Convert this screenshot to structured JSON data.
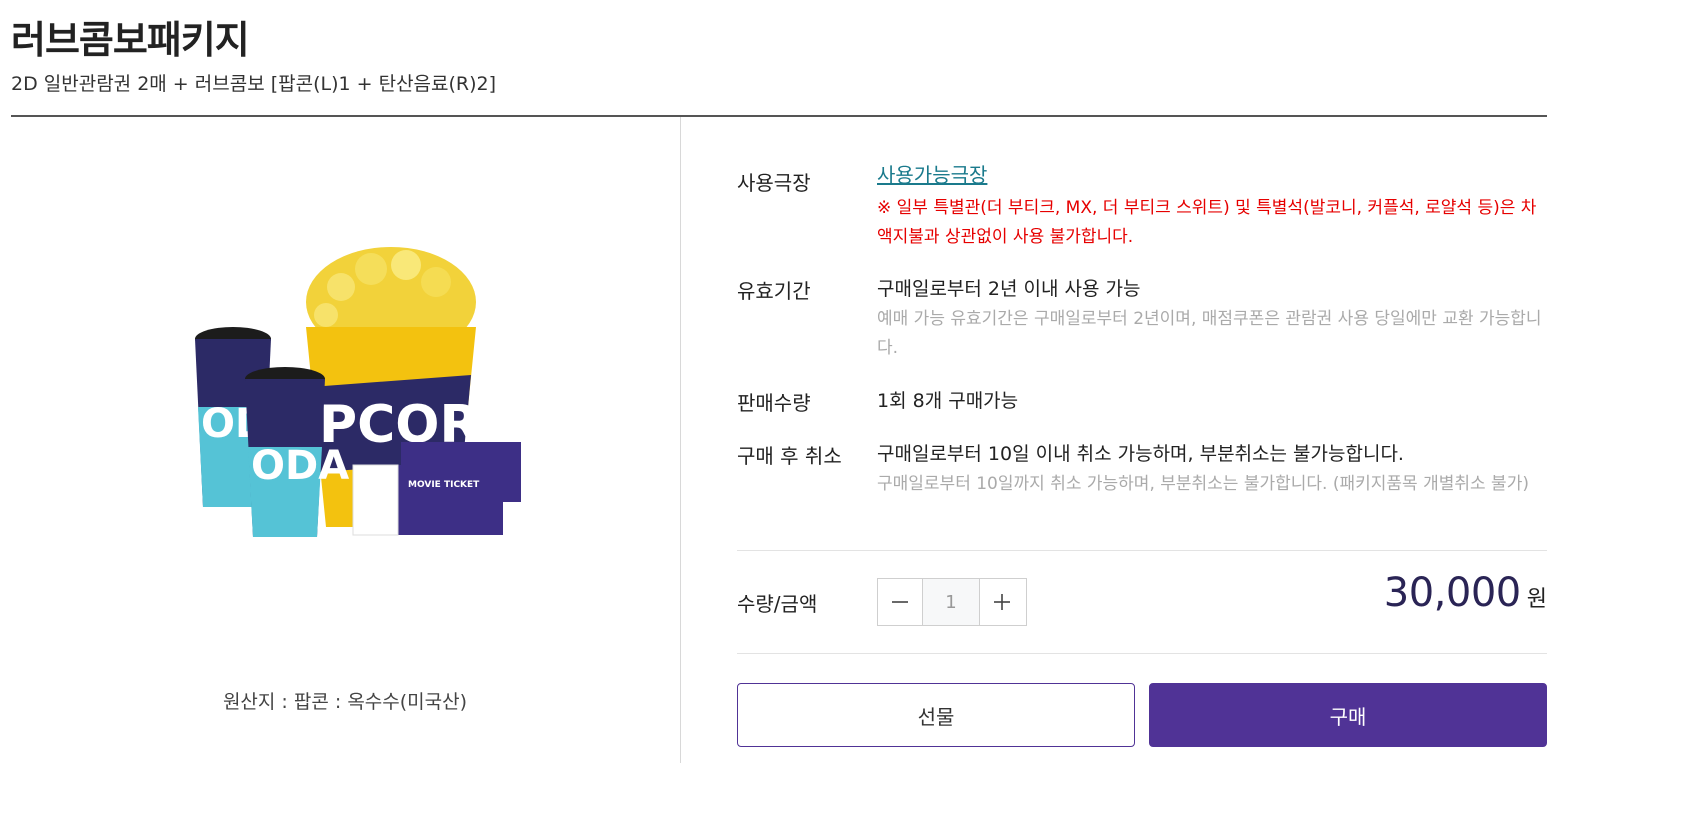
{
  "product": {
    "title": "러브콤보패키지",
    "subtitle": "2D 일반관람권 2매 + 러브콤보 [팝콘(L)1 + 탄산음료(R)2]",
    "origin": "원산지 : 팝콘 : 옥수수(미국산)",
    "image_text": {
      "cup_text": "ODA",
      "bucket_text": "PCORN",
      "ticket_text": "MOVIE TICKET"
    }
  },
  "details": {
    "theater": {
      "label": "사용극장",
      "link": "사용가능극장",
      "note": "※ 일부 특별관(더 부티크, MX, 더 부티크 스위트) 및 특별석(발코니, 커플석, 로얄석 등)은 차액지불과 상관없이 사용 불가합니다."
    },
    "validity": {
      "label": "유효기간",
      "value": "구매일로부터 2년 이내 사용 가능",
      "note": "예매 가능 유효기간은 구매일로부터 2년이며, 매점쿠폰은 관람권 사용 당일에만 교환 가능합니다."
    },
    "sales_limit": {
      "label": "판매수량",
      "value": "1회 8개 구매가능"
    },
    "cancel": {
      "label": "구매 후 취소",
      "value": "구매일로부터 10일 이내 취소 가능하며, 부분취소는 불가능합니다.",
      "note": "구매일로부터 10일까지 취소 가능하며, 부분취소는 불가합니다. (패키지품목 개별취소 불가)"
    }
  },
  "purchase": {
    "qty_label": "수량/금액",
    "quantity": "1",
    "price": "30,000",
    "currency": "원",
    "gift_label": "선물",
    "buy_label": "구매"
  },
  "colors": {
    "brand": "#503396",
    "link": "#1a7a8c",
    "warning": "#e60000",
    "price": "#2a2455"
  },
  "icons": [
    "minus-icon",
    "plus-icon"
  ]
}
